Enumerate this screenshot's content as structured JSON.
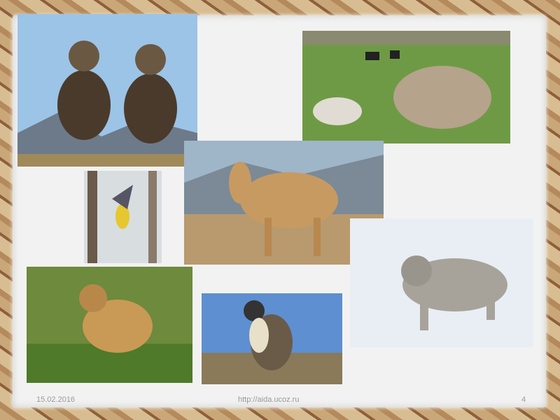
{
  "slide": {
    "date": "15.02.2016",
    "url": "http://aida.ucoz.ru",
    "page_number": "4"
  },
  "photos": [
    {
      "icon": "bighorn-sheep-photo"
    },
    {
      "icon": "yak-photo"
    },
    {
      "icon": "camel-photo"
    },
    {
      "icon": "bird-photo"
    },
    {
      "icon": "snow-leopard-photo"
    },
    {
      "icon": "marmot-photo"
    },
    {
      "icon": "falcon-photo"
    }
  ]
}
